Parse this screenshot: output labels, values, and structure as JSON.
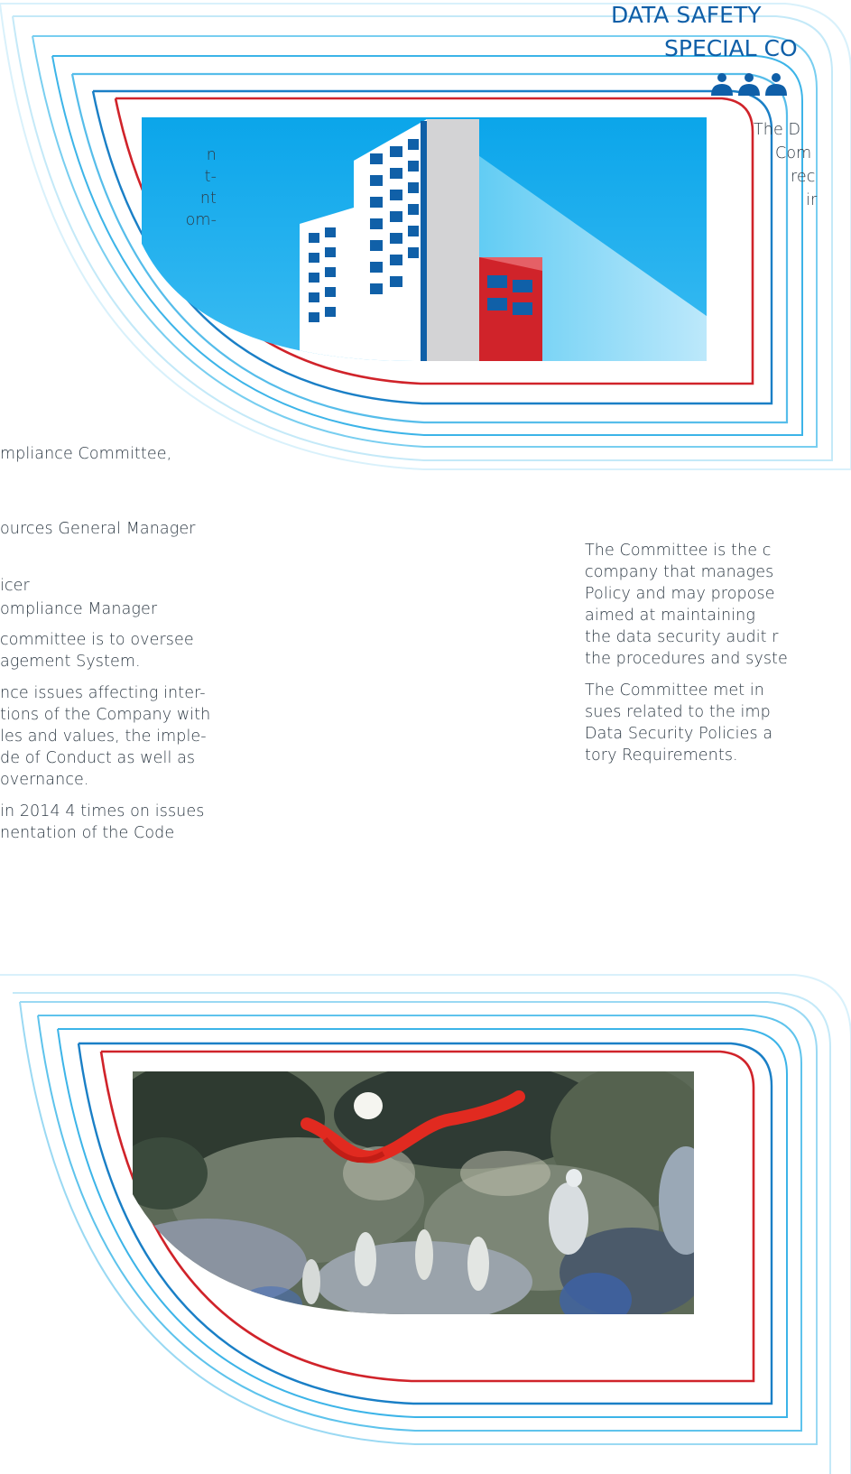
{
  "colors": {
    "brand_blue": "#0f5fa8",
    "accent_red": "#d0232a",
    "sky": "#18aaea",
    "text": "#2e3a45"
  },
  "header": {
    "title_line1": "DATA SAFETY",
    "title_line2": "SPECIAL CO",
    "people_icon": "three-people-icon"
  },
  "right_intro": [
    "The D",
    "Com",
    "rec",
    "ir"
  ],
  "left_fragments": [
    "n",
    "t-",
    "nt",
    "om-"
  ],
  "left_column": {
    "p1": "mpliance Committee,",
    "p2": "ources General Manager",
    "p3": "icer",
    "p4": "ompliance Manager",
    "p5_l1": "committee is to oversee",
    "p5_l2": "agement System.",
    "p6_l1": "nce issues affecting inter-",
    "p6_l2": "tions of the Company with",
    "p6_l3": "les and values, the imple-",
    "p6_l4": "de of Conduct as well as",
    "p6_l5": "overnance.",
    "p7_l1": "in 2014 4 times on issues",
    "p7_l2": "nentation of the Code"
  },
  "right_column": {
    "p1_l1": "The Committee is the c",
    "p1_l2": "company that manages",
    "p1_l3": "Policy and may propose",
    "p1_l4": "aimed at maintaining",
    "p1_l5": "the data security audit r",
    "p1_l6": "the procedures and syste",
    "p2_l1": "The Committee met in",
    "p2_l2": "sues related to the imp",
    "p2_l3": "Data Security Policies a",
    "p2_l4": "tory Requirements."
  },
  "images": {
    "top": "building-illustration",
    "bottom": "abstract-painting"
  }
}
